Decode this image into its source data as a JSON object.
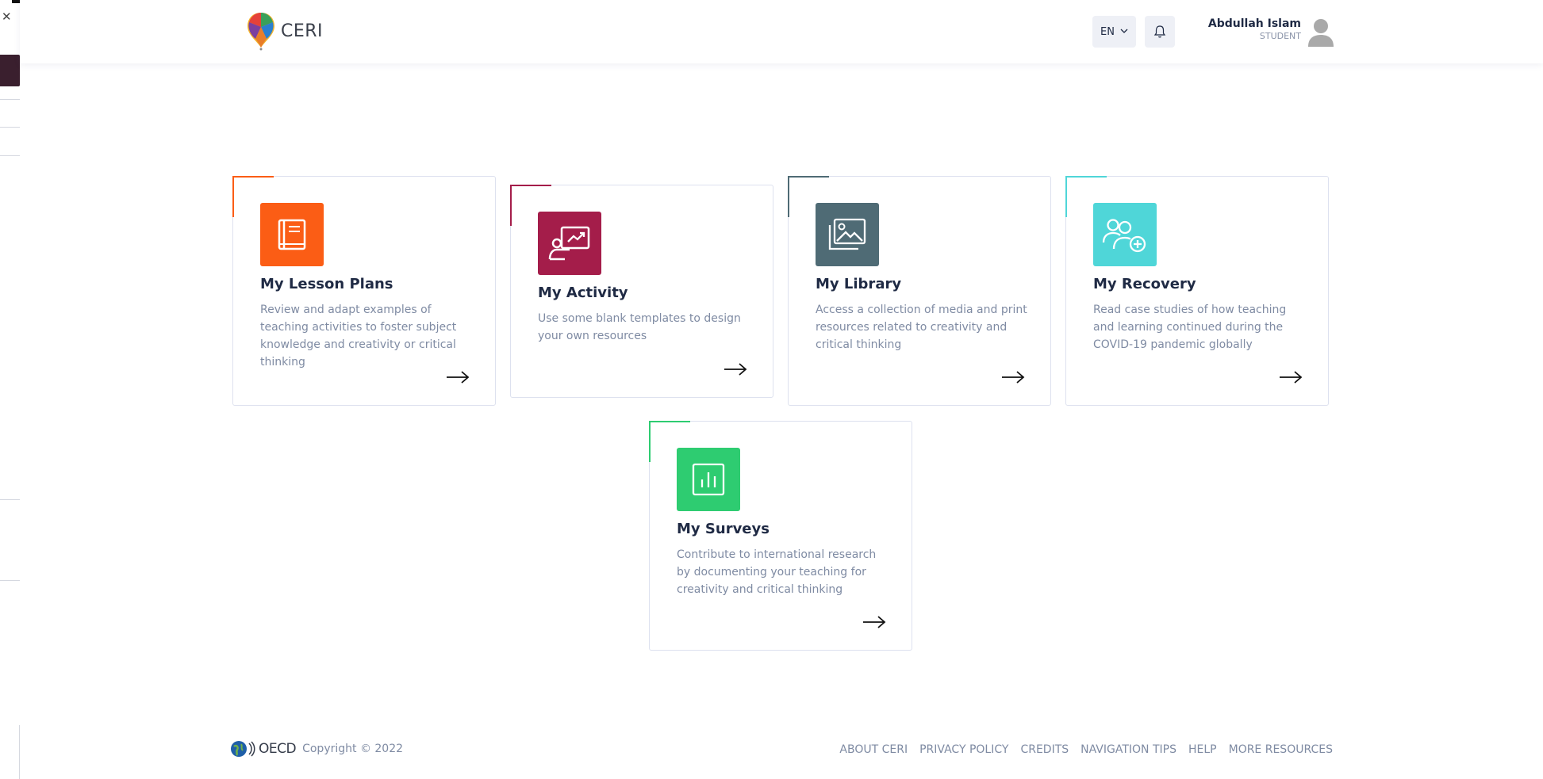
{
  "header": {
    "logo_text": "CERI",
    "language": "EN",
    "user": {
      "name": "Abdullah Islam",
      "role": "STUDENT"
    }
  },
  "cards": [
    {
      "title": "My Lesson Plans",
      "description": "Review and adapt examples of teaching activities to foster subject knowledge and creativity or critical thinking",
      "color": "#fb5d15",
      "icon": "book-icon"
    },
    {
      "title": "My Activity",
      "description": "Use some blank templates to design your own resources",
      "color": "#a41d4a",
      "icon": "presentation-icon"
    },
    {
      "title": "My Library",
      "description": "Access a collection of media and print resources related to creativity and critical thinking",
      "color": "#4f6b75",
      "icon": "images-icon"
    },
    {
      "title": "My Recovery",
      "description": "Read case studies of how teaching and learning continued during the COVID-19 pandemic globally",
      "color": "#4fd6d8",
      "icon": "users-plus-icon"
    },
    {
      "title": "My Surveys",
      "description": "Contribute to international research by documenting your teaching for creativity and critical thinking",
      "color": "#2ecc71",
      "icon": "bar-chart-icon"
    }
  ],
  "footer": {
    "org": "OECD",
    "copyright": "Copyright © 2022",
    "links": [
      "ABOUT CERI",
      "PRIVACY POLICY",
      "CREDITS",
      "NAVIGATION TIPS",
      "HELP",
      "MORE RESOURCES"
    ]
  }
}
